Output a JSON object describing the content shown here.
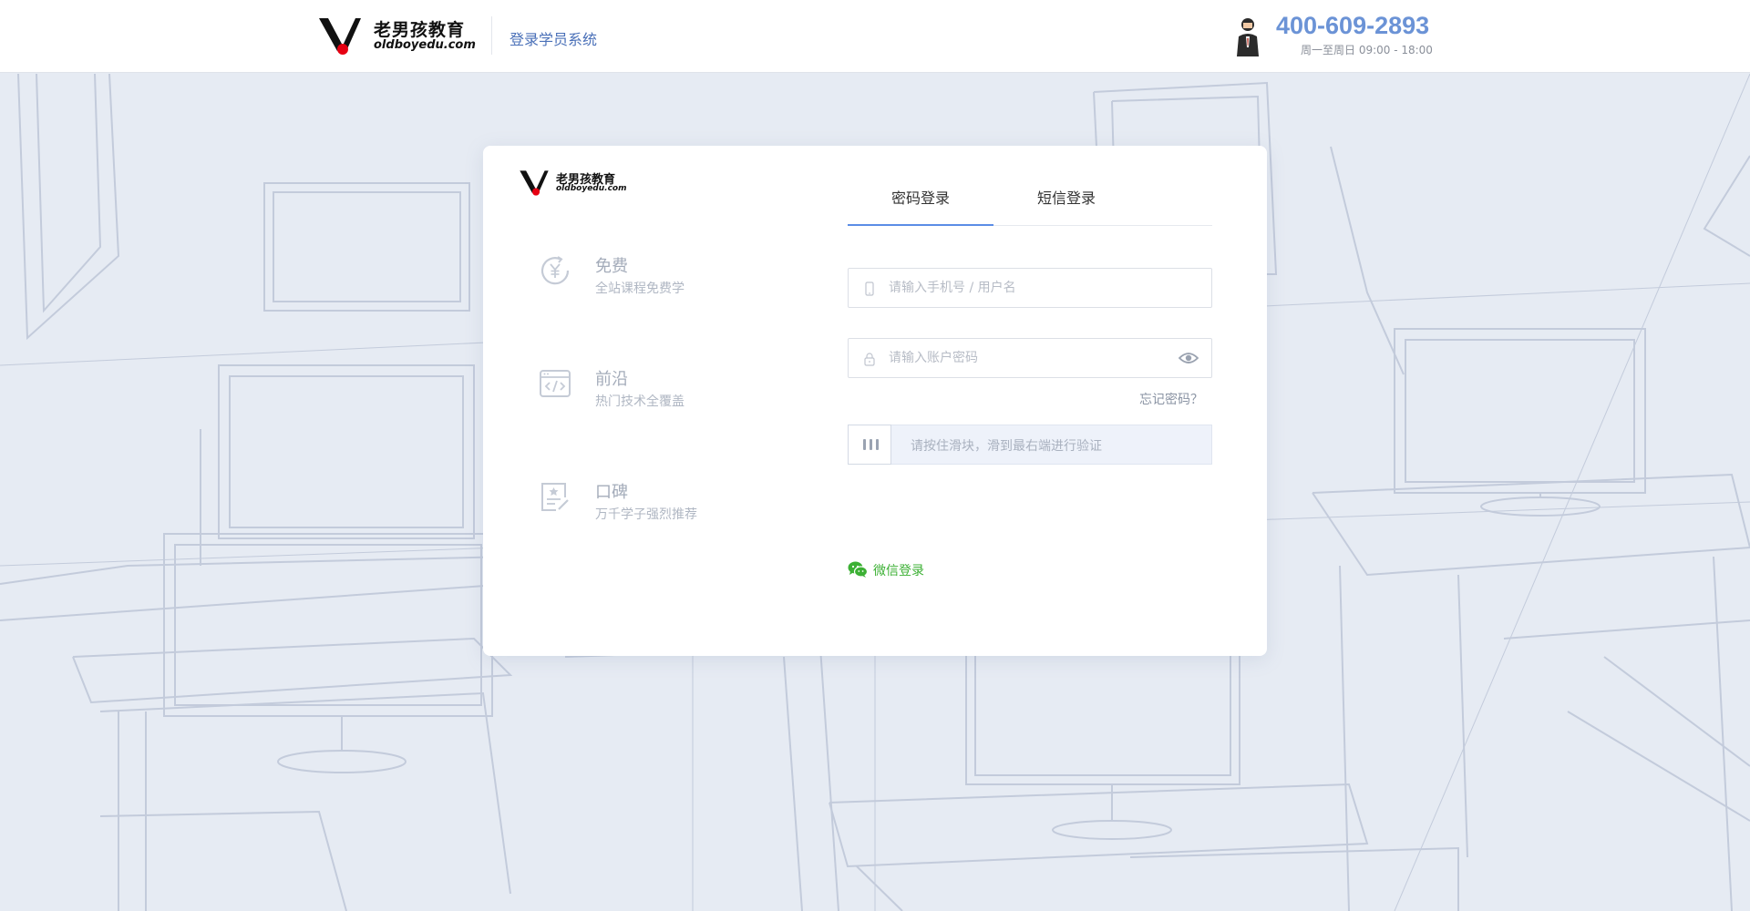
{
  "header": {
    "brand_cn": "老男孩教育",
    "brand_en": "oldboyedu.com",
    "system_title": "登录学员系统",
    "hotline": "400-609-2893",
    "hours": "周一至周日 09:00 - 18:00"
  },
  "card": {
    "brand_cn": "老男孩教育",
    "brand_en": "oldboyedu.com",
    "features": [
      {
        "title": "免费",
        "desc": "全站课程免费学",
        "icon": "yen-icon"
      },
      {
        "title": "前沿",
        "desc": "热门技术全覆盖",
        "icon": "code-icon"
      },
      {
        "title": "口碑",
        "desc": "万千学子强烈推荐",
        "icon": "certificate-icon"
      }
    ],
    "tabs": [
      {
        "label": "密码登录",
        "active": true
      },
      {
        "label": "短信登录",
        "active": false
      }
    ],
    "username": {
      "value": "",
      "placeholder": "请输入手机号 / 用户名"
    },
    "password": {
      "value": "",
      "placeholder": "请输入账户密码"
    },
    "forgot": "忘记密码？",
    "slider_text": "请按住滑块，滑到最右端进行验证",
    "wechat_label": "微信登录"
  },
  "colors": {
    "accent": "#5b8de6",
    "hotline": "#6b93d6",
    "wechat": "#3cb034",
    "background": "#e6ebf3"
  }
}
